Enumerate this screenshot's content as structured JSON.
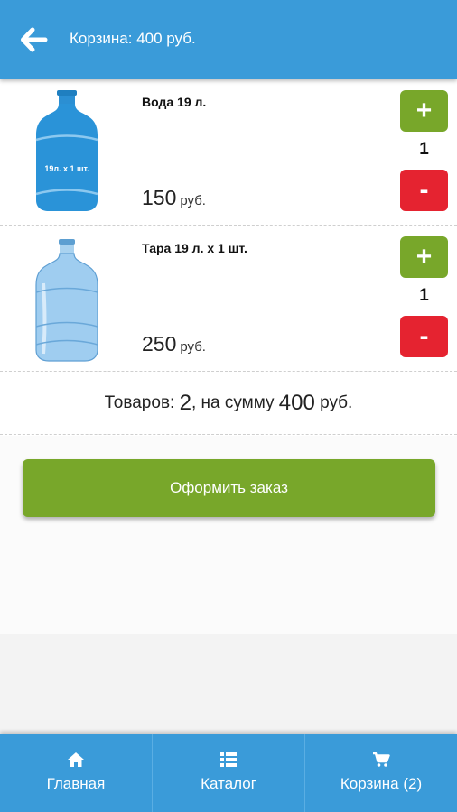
{
  "header": {
    "title": "Корзина: 400 руб.",
    "back_icon": "arrow-left-icon",
    "background": "#3a9bd9"
  },
  "cart": {
    "items": [
      {
        "name": "Вода 19 л.",
        "price": "150",
        "currency": "руб.",
        "quantity": "1",
        "plus_label": "+",
        "minus_label": "-",
        "bottle_label": "19л. x 1 шт."
      },
      {
        "name": "Тара 19 л. x 1 шт.",
        "price": "250",
        "currency": "руб.",
        "quantity": "1",
        "plus_label": "+",
        "minus_label": "-"
      }
    ]
  },
  "summary": {
    "prefix": "Товаров: ",
    "count": "2",
    "middle": ", на сумму ",
    "total": "400",
    "currency": " руб."
  },
  "order_button": {
    "label": "Оформить заказ",
    "color": "#78a72a"
  },
  "nav": {
    "items": [
      {
        "label": "Главная",
        "icon": "home-icon"
      },
      {
        "label": "Каталог",
        "icon": "list-icon"
      },
      {
        "label": "Корзина (2)",
        "icon": "cart-icon"
      }
    ]
  },
  "colors": {
    "accent": "#3a9bd9",
    "plus": "#78a72a",
    "minus": "#e52330"
  }
}
